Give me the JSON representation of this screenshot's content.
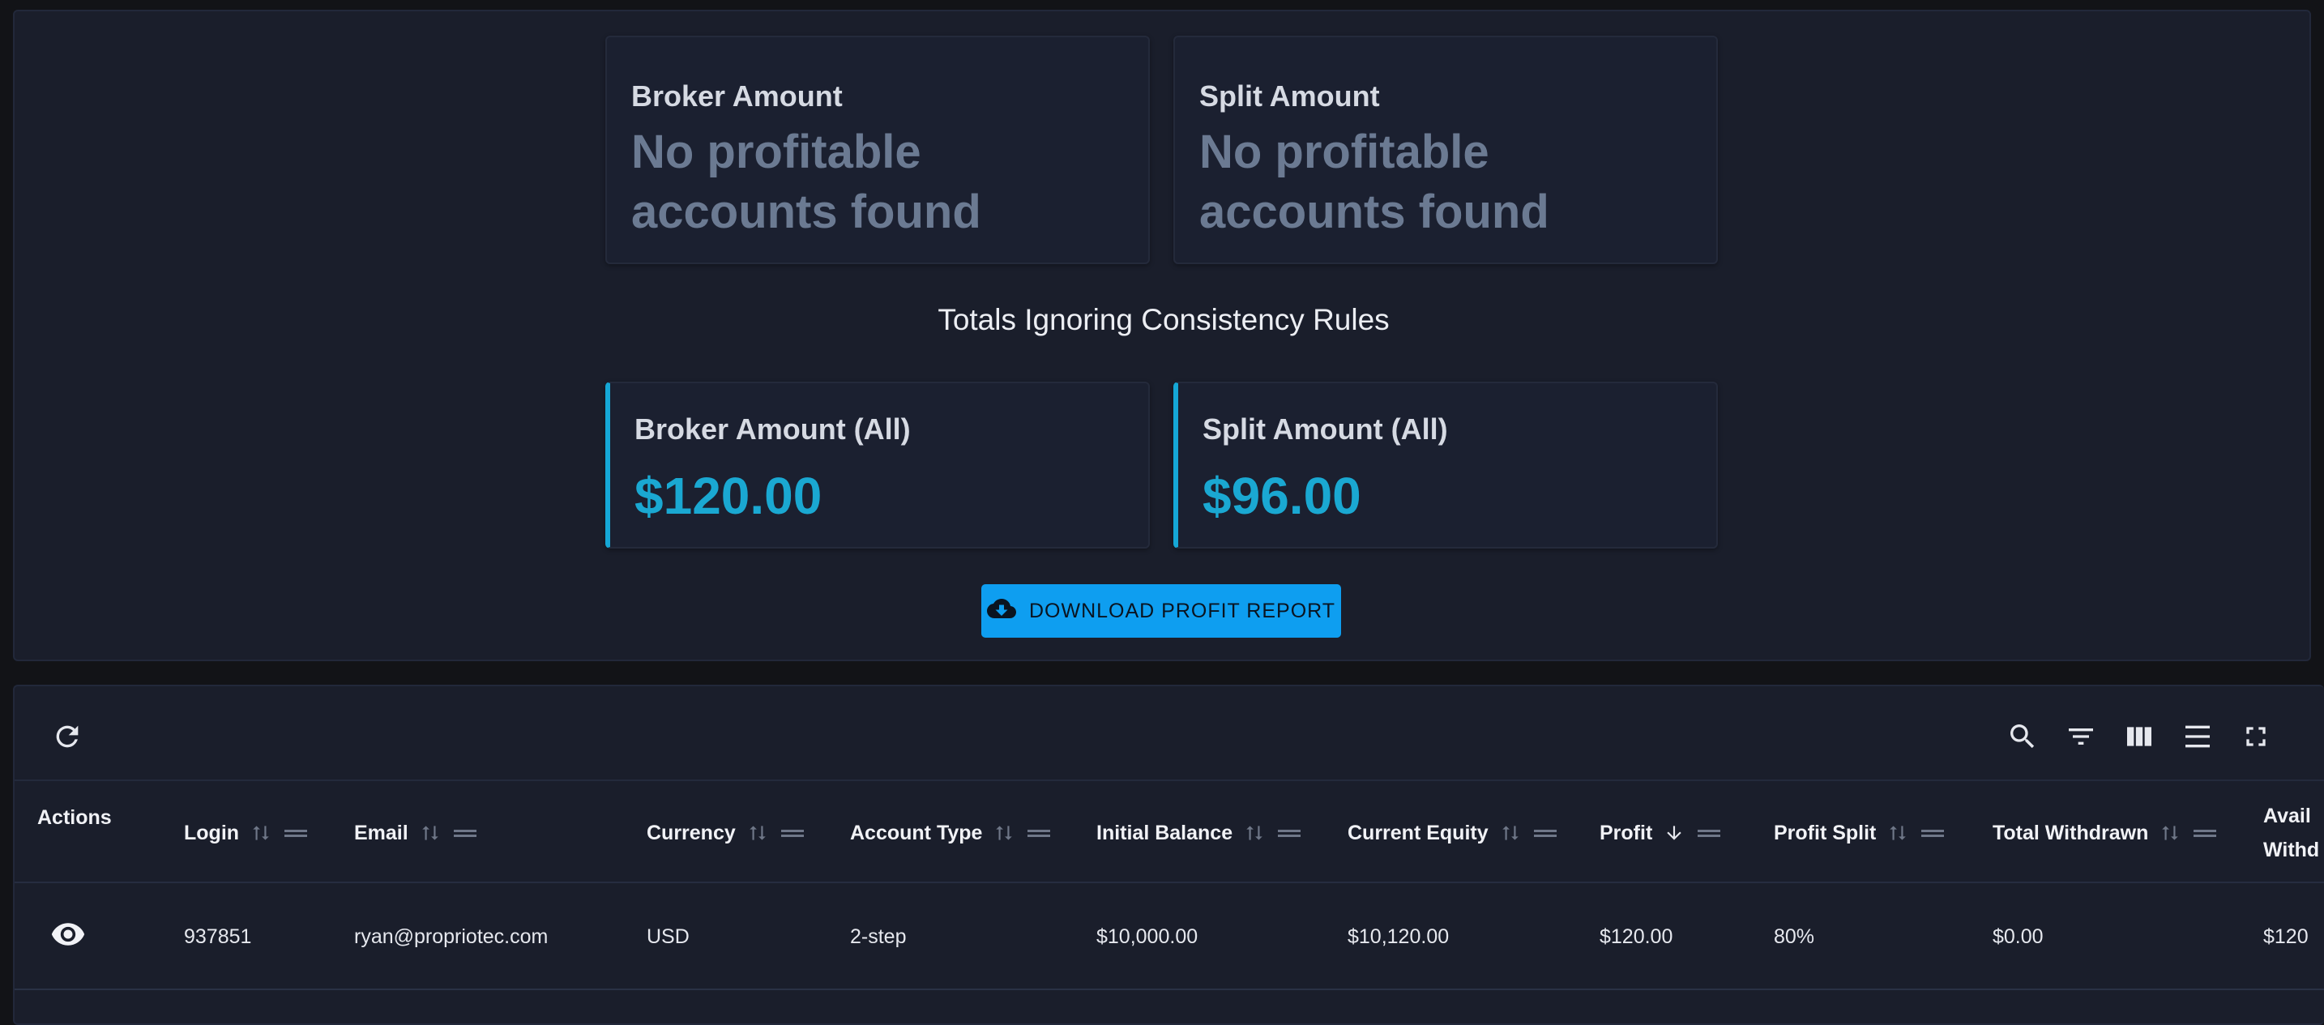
{
  "summary": {
    "cards_top": [
      {
        "title": "Broker Amount",
        "message": "No profitable accounts found"
      },
      {
        "title": "Split Amount",
        "message": "No profitable accounts found"
      }
    ],
    "totals_title": "Totals Ignoring Consistency Rules",
    "cards_totals": [
      {
        "title": "Broker Amount (All)",
        "value": "$120.00"
      },
      {
        "title": "Split Amount (All)",
        "value": "$96.00"
      }
    ],
    "download_label": "DOWNLOAD PROFIT REPORT",
    "accent_color": "#15a7d6",
    "button_color": "#0e9ef0"
  },
  "table": {
    "toolbar_icons": [
      "refresh-icon",
      "search-icon",
      "filter-icon",
      "columns-icon",
      "density-icon",
      "fullscreen-icon"
    ],
    "columns": [
      {
        "label": "Actions"
      },
      {
        "label": "Login"
      },
      {
        "label": "Email"
      },
      {
        "label": "Currency"
      },
      {
        "label": "Account Type"
      },
      {
        "label": "Initial Balance"
      },
      {
        "label": "Current Equity"
      },
      {
        "label": "Profit",
        "sorted": "descending"
      },
      {
        "label": "Profit Split"
      },
      {
        "label": "Total Withdrawn"
      },
      {
        "label": "Avail",
        "label2": "Withd"
      }
    ],
    "rows": [
      {
        "login": "937851",
        "email": "ryan@propriotec.com",
        "currency": "USD",
        "account_type": "2-step",
        "initial_balance": "$10,000.00",
        "current_equity": "$10,120.00",
        "profit": "$120.00",
        "profit_split": "80%",
        "total_withdrawn": "$0.00",
        "available": "$120"
      }
    ]
  }
}
